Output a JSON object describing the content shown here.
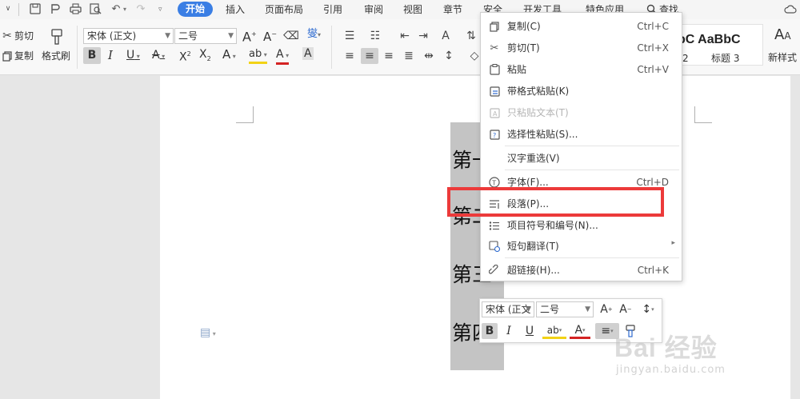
{
  "menubar": {
    "tabs": [
      "开始",
      "插入",
      "页面布局",
      "引用",
      "审阅",
      "视图",
      "章节",
      "安全",
      "开发工具",
      "特色应用"
    ],
    "search_label": "查找"
  },
  "ribbon": {
    "cut": "剪切",
    "copy": "复制",
    "format_painter": "格式刷",
    "font_name": "宋体 (正文)",
    "font_size": "二号",
    "style_preview_1": "bC AaBbC",
    "style_preview_2": "AaBbCcI",
    "style_label_1": "2",
    "style_label_2": "标题 3",
    "new_style": "新样式"
  },
  "document": {
    "lines": [
      "第一",
      "第二",
      "第三",
      "第四"
    ]
  },
  "context_menu": {
    "items": [
      {
        "label": "复制(C)",
        "shortcut": "Ctrl+C",
        "icon": "copy-icon"
      },
      {
        "label": "剪切(T)",
        "shortcut": "Ctrl+X",
        "icon": "scissors-icon"
      },
      {
        "label": "粘贴",
        "shortcut": "Ctrl+V",
        "icon": "paste-icon"
      },
      {
        "label": "带格式粘贴(K)",
        "shortcut": "",
        "icon": "paste-format-icon"
      },
      {
        "label": "只粘贴文本(T)",
        "shortcut": "",
        "icon": "paste-text-icon",
        "disabled": true
      },
      {
        "label": "选择性粘贴(S)...",
        "shortcut": "",
        "icon": "paste-special-icon"
      },
      {
        "label": "汉字重选(V)",
        "shortcut": "",
        "icon": ""
      },
      {
        "label": "字体(F)...",
        "shortcut": "Ctrl+D",
        "icon": "font-icon"
      },
      {
        "label": "段落(P)...",
        "shortcut": "",
        "icon": "paragraph-icon"
      },
      {
        "label": "项目符号和编号(N)...",
        "shortcut": "",
        "icon": "bullets-icon"
      },
      {
        "label": "短句翻译(T)",
        "shortcut": "",
        "icon": "translate-icon"
      },
      {
        "label": "超链接(H)...",
        "shortcut": "Ctrl+K",
        "icon": "link-icon"
      }
    ]
  },
  "mini_toolbar": {
    "font_name": "宋体 (正文",
    "font_size": "二号"
  },
  "watermark": {
    "brand": "Bai 经验",
    "url": "jingyan.baidu.com"
  },
  "colors": {
    "active_tab": "#3a7ee4",
    "highlight_box": "#ec3a3a",
    "selection": "#c4c4c4"
  }
}
